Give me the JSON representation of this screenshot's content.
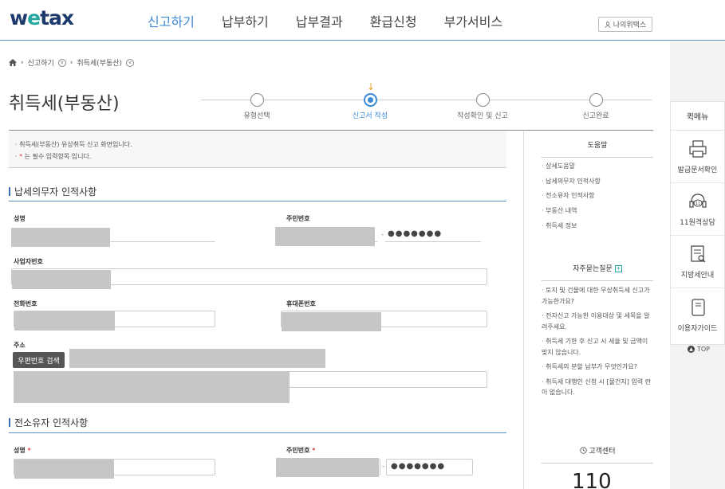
{
  "header": {
    "logo_pre": "w",
    "logo_o": "e",
    "logo_post": "tax",
    "nav": [
      "신고하기",
      "납부하기",
      "납부결과",
      "환급신청",
      "부가서비스"
    ],
    "mywetax": "나의위택스"
  },
  "breadcrumb": {
    "items": [
      "신고하기",
      "취득세(부동산)"
    ]
  },
  "page_title": "취득세(부동산)",
  "stepper": {
    "steps": [
      "유형선택",
      "신고서 작성",
      "작성확인 및 신고",
      "신고완료"
    ],
    "active_index": 1
  },
  "notice": {
    "line1": "취득세(부동산) 유상취득 신고 화면입니다.",
    "line2_star": "*",
    "line2": "는 필수 입력항목 입니다."
  },
  "taxpayer": {
    "title": "납세의무자 인적사항",
    "name_label": "성명",
    "rrn_label": "주민번호",
    "rrn_dash": "-",
    "rrn_masked": "●●●●●●●",
    "biz_label": "사업자번호",
    "phone_label": "전화번호",
    "mobile_label": "휴대폰번호",
    "address_label": "주소",
    "zip_button": "우편번호 검색"
  },
  "prev_owner": {
    "title": "전소유자 인적사항",
    "name_label": "성명",
    "rrn_label": "주민번호",
    "required_mark": "*",
    "rrn_dash": "-",
    "rrn_masked": "●●●●●●●"
  },
  "help": {
    "title": "도움말",
    "links": [
      "상세도움말",
      "납세의무자 인적사항",
      "전소유자 인적사항",
      "부동산 내역",
      "취득세 정보"
    ]
  },
  "faq": {
    "title": "자주묻는질문",
    "links": [
      "토지 및 건물에 대한 무상취득세 신고가 가능한가요?",
      "전자신고 가능한 이용대상 및 세목을 알려주세요.",
      "취득세 기한 후 신고 시 세율 및 금액이 맞지 않습니다.",
      "취득세의 분할 납부가 무엇인가요?",
      "취득세 대행인 신청 시 [물건지] 입력 란이 없습니다."
    ]
  },
  "customer_center": {
    "title": "고객센터",
    "number": "110"
  },
  "quickmenu": {
    "title": "퀵메뉴",
    "items": [
      "발급문서확인",
      "11원격상담",
      "지방세안내",
      "이용자가이드"
    ],
    "icon_badge": "11",
    "top": "TOP"
  }
}
